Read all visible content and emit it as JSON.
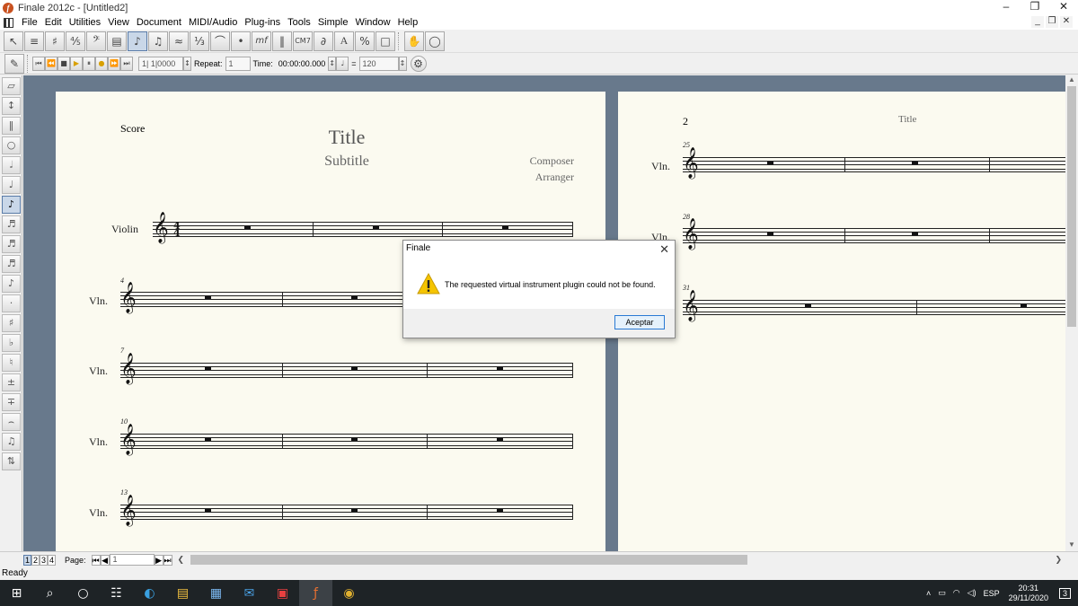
{
  "window": {
    "title": "Finale 2012c - [Untitled2]"
  },
  "menu": [
    "File",
    "Edit",
    "Utilities",
    "View",
    "Document",
    "MIDI/Audio",
    "Plug-ins",
    "Tools",
    "Simple",
    "Window",
    "Help"
  ],
  "playback": {
    "position": "1| 1|0000",
    "repeat_label": "Repeat:",
    "repeat_value": "1",
    "time_label": "Time:",
    "time_value": "00:00:00.000",
    "tempo_eq": "=",
    "tempo_value": "120"
  },
  "score": {
    "label": "Score",
    "title": "Title",
    "subtitle": "Subtitle",
    "composer": "Composer",
    "arranger": "Arranger",
    "first_staff_name": "Violin",
    "staff_name": "Vln.",
    "systems_p1": [
      "4",
      "7",
      "10",
      "13"
    ],
    "page2_number": "2",
    "page2_header": "Title",
    "systems_p2": [
      "25",
      "28",
      "31"
    ]
  },
  "dialog": {
    "title": "Finale",
    "message": "The requested virtual instrument plugin could not be found.",
    "button": "Aceptar"
  },
  "pagebar": {
    "views": [
      "1",
      "2",
      "3",
      "4"
    ],
    "page_label": "Page:",
    "page_value": "1"
  },
  "status": "Ready",
  "taskbar": {
    "lang": "ESP",
    "time": "20:31",
    "date": "29/11/2020",
    "notifications": "3"
  }
}
